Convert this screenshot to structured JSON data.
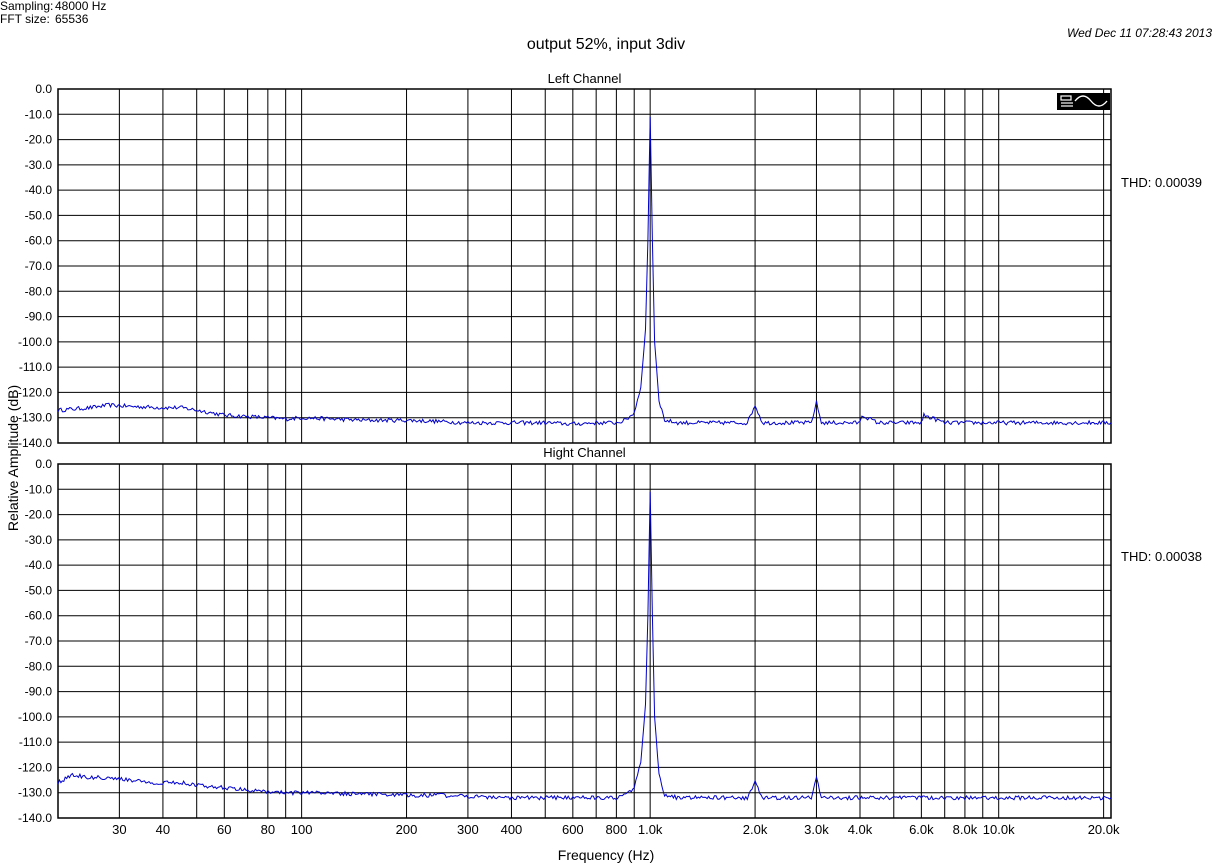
{
  "header": {
    "sampling_label": "Sampling:",
    "sampling_value": "48000 Hz",
    "fft_label": "FFT size:",
    "fft_value": "65536",
    "timestamp": "Wed Dec 11 07:28:43 2013",
    "title": "output 52%, input 3div"
  },
  "colors": {
    "trace": "#0000cc",
    "grid": "#000000",
    "background": "#ffffff"
  },
  "legend_icon": "sine-wave-icon",
  "chart_data": [
    {
      "type": "line",
      "title": "Left Channel",
      "xlabel": "Frequency (Hz)",
      "ylabel": "Relative Amplitude (dB)",
      "xscale": "log",
      "xlim": [
        20,
        21000
      ],
      "ylim": [
        -140,
        0
      ],
      "grid": true,
      "xticks": [
        30,
        40,
        60,
        80,
        100,
        200,
        300,
        400,
        600,
        800,
        1000,
        2000,
        3000,
        4000,
        6000,
        8000,
        10000,
        20000
      ],
      "xtick_labels": [
        "30",
        "40",
        "60",
        "80",
        "100",
        "200",
        "300",
        "400",
        "600",
        "800",
        "1.0k",
        "2.0k",
        "3.0k",
        "4.0k",
        "6.0k",
        "8.0k",
        "10.0k",
        "20.0k"
      ],
      "yticks": [
        0,
        -10,
        -20,
        -30,
        -40,
        -50,
        -60,
        -70,
        -80,
        -90,
        -100,
        -110,
        -120,
        -130,
        -140
      ],
      "ytick_labels": [
        "0.0",
        "-10.0",
        "-20.0",
        "-30.0",
        "-40.0",
        "-50.0",
        "-60.0",
        "-70.0",
        "-80.0",
        "-90.0",
        "-100.0",
        "-110.0",
        "-120.0",
        "-130.0",
        "-140.0"
      ],
      "thd_text": "THD: 0.00039",
      "series": [
        {
          "x": [
            20,
            25,
            28,
            32,
            40,
            45,
            50,
            60,
            70,
            80,
            90,
            100,
            150,
            200,
            250,
            300,
            400,
            500,
            600,
            700,
            800,
            850,
            900,
            940,
            970,
            985,
            1000,
            1015,
            1030,
            1060,
            1100,
            1200,
            1500,
            1900,
            2000,
            2100,
            2500,
            2900,
            3000,
            3100,
            3500,
            4000,
            4050,
            4500,
            5000,
            6000,
            6100,
            7000,
            8000,
            9000,
            10000,
            12000,
            15000,
            18000,
            20000,
            21000
          ],
          "y": [
            -127,
            -126,
            -125,
            -125.5,
            -126,
            -126,
            -127,
            -129,
            -129.5,
            -130,
            -130.5,
            -130,
            -131,
            -131,
            -131.5,
            -132,
            -132,
            -132,
            -132.5,
            -132,
            -132,
            -131,
            -128,
            -118,
            -95,
            -60,
            -11,
            -60,
            -100,
            -123,
            -131,
            -132,
            -132,
            -132,
            -125,
            -132,
            -132,
            -132,
            -124,
            -132,
            -132,
            -132,
            -129,
            -132,
            -132,
            -132,
            -129,
            -132,
            -132,
            -132,
            -132,
            -132,
            -132,
            -132,
            -132,
            -132
          ]
        }
      ]
    },
    {
      "type": "line",
      "title": "Hight Channel",
      "xlabel": "Frequency (Hz)",
      "ylabel": "Relative Amplitude (dB)",
      "xscale": "log",
      "xlim": [
        20,
        21000
      ],
      "ylim": [
        -140,
        0
      ],
      "grid": true,
      "xticks": [
        30,
        40,
        60,
        80,
        100,
        200,
        300,
        400,
        600,
        800,
        1000,
        2000,
        3000,
        4000,
        6000,
        8000,
        10000,
        20000
      ],
      "xtick_labels": [
        "30",
        "40",
        "60",
        "80",
        "100",
        "200",
        "300",
        "400",
        "600",
        "800",
        "1.0k",
        "2.0k",
        "3.0k",
        "4.0k",
        "6.0k",
        "8.0k",
        "10.0k",
        "20.0k"
      ],
      "yticks": [
        0,
        -10,
        -20,
        -30,
        -40,
        -50,
        -60,
        -70,
        -80,
        -90,
        -100,
        -110,
        -120,
        -130,
        -140
      ],
      "ytick_labels": [
        "0.0",
        "-10.0",
        "-20.0",
        "-30.0",
        "-40.0",
        "-50.0",
        "-60.0",
        "-70.0",
        "-80.0",
        "-90.0",
        "-100.0",
        "-110.0",
        "-120.0",
        "-130.0",
        "-140.0"
      ],
      "thd_text": "THD: 0.00038",
      "series": [
        {
          "x": [
            20,
            22,
            25,
            28,
            32,
            38,
            45,
            50,
            60,
            70,
            80,
            90,
            100,
            150,
            200,
            250,
            300,
            400,
            500,
            600,
            700,
            800,
            850,
            900,
            940,
            970,
            985,
            1000,
            1015,
            1030,
            1060,
            1100,
            1200,
            1500,
            1900,
            2000,
            2100,
            2500,
            2900,
            3000,
            3100,
            3500,
            4000,
            5000,
            6000,
            7000,
            8000,
            10000,
            12000,
            15000,
            18000,
            20000,
            21000
          ],
          "y": [
            -126,
            -123,
            -124,
            -124,
            -125,
            -126,
            -126,
            -127,
            -128,
            -129,
            -129.5,
            -130,
            -130,
            -130.5,
            -131,
            -131,
            -131.5,
            -132,
            -132,
            -132,
            -132,
            -132,
            -131,
            -128,
            -118,
            -95,
            -60,
            -11,
            -60,
            -100,
            -123,
            -131,
            -132,
            -132,
            -132,
            -126,
            -132,
            -132,
            -132,
            -124,
            -132,
            -132,
            -132,
            -132,
            -132,
            -132,
            -132,
            -132,
            -132,
            -132,
            -132,
            -132,
            -132
          ]
        }
      ]
    }
  ]
}
